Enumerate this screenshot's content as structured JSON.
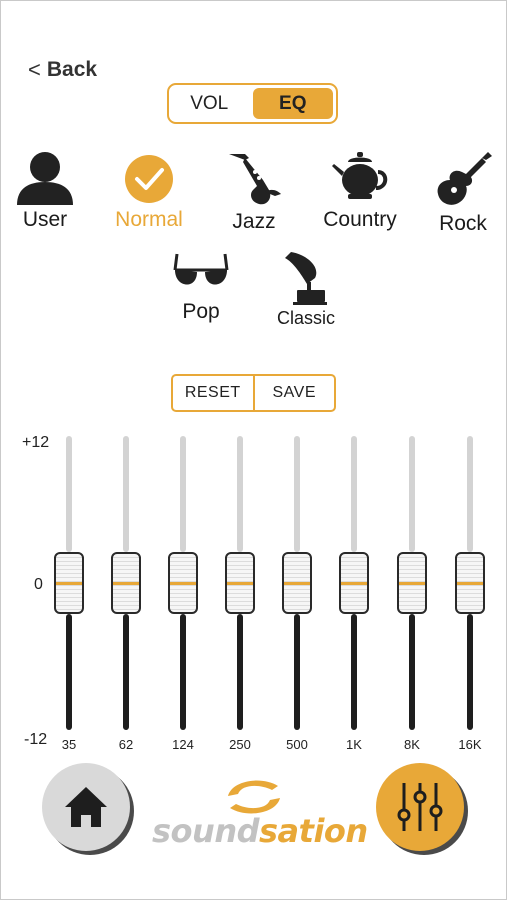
{
  "nav": {
    "back_label": "Back"
  },
  "mode_toggle": {
    "options": [
      "VOL",
      "EQ"
    ],
    "selected": "EQ"
  },
  "presets": [
    {
      "label": "User",
      "icon": "user-icon"
    },
    {
      "label": "Normal",
      "icon": "checkmark-icon",
      "selected": true
    },
    {
      "label": "Jazz",
      "icon": "saxophone-icon"
    },
    {
      "label": "Country",
      "icon": "teapot-icon"
    },
    {
      "label": "Rock",
      "icon": "electric-guitar-icon"
    },
    {
      "label": "Pop",
      "icon": "sunglasses-icon"
    },
    {
      "label": "Classic",
      "icon": "gramophone-icon"
    }
  ],
  "actions": {
    "reset_label": "RESET",
    "save_label": "SAVE"
  },
  "equalizer": {
    "scale_labels": {
      "max": "+12",
      "zero": "0",
      "min": "-12"
    },
    "range_db": [
      -12,
      12
    ],
    "bands": [
      {
        "freq": "35",
        "gain_db": 0
      },
      {
        "freq": "62",
        "gain_db": 0
      },
      {
        "freq": "124",
        "gain_db": 0
      },
      {
        "freq": "250",
        "gain_db": 0
      },
      {
        "freq": "500",
        "gain_db": 0
      },
      {
        "freq": "1K",
        "gain_db": 0
      },
      {
        "freq": "8K",
        "gain_db": 0
      },
      {
        "freq": "16K",
        "gain_db": 0
      }
    ]
  },
  "bottom_bar": {
    "home_icon": "home-icon",
    "eq_icon": "sliders-icon",
    "brand": {
      "part1": "sound",
      "part2": "sation"
    }
  },
  "colors": {
    "accent": "#e8a838",
    "dark": "#1e1e1e",
    "track_light": "#d3d3d3",
    "home_bg": "#d9d9d9"
  }
}
